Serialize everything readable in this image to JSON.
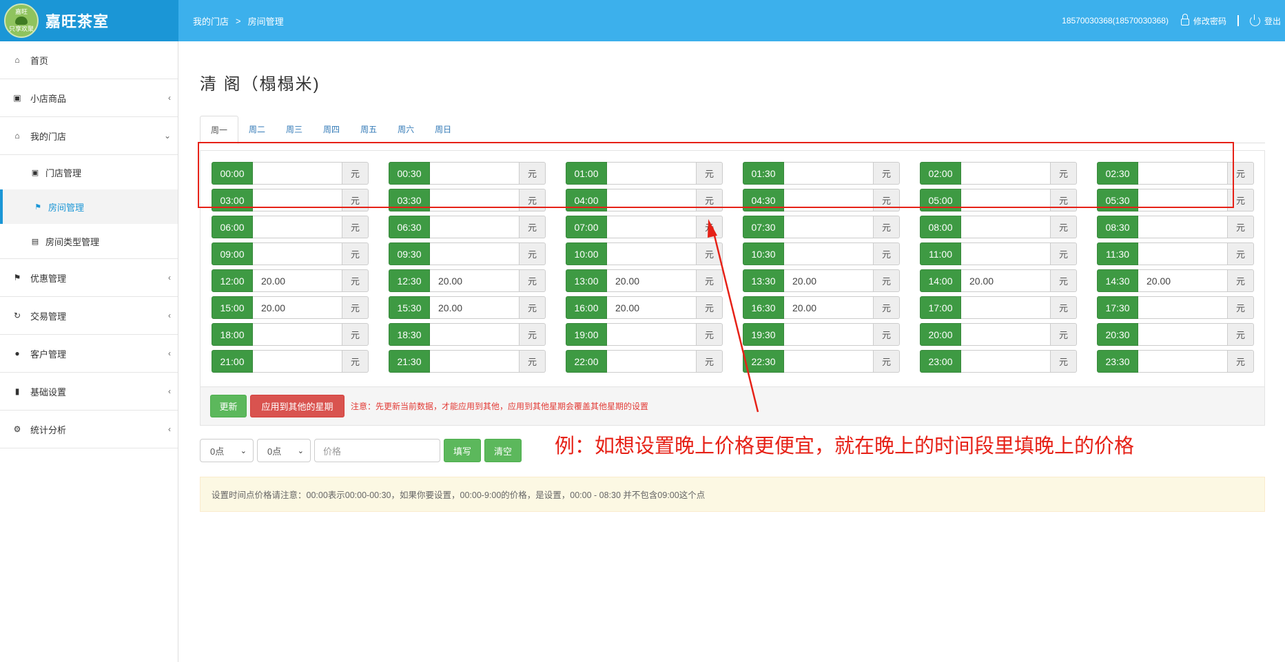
{
  "app": {
    "logo_text_top": "嘉旺",
    "logo_text_bottom": "只享欢聚",
    "logo_title": "嘉旺茶室"
  },
  "breadcrumb": {
    "items": [
      "我的门店",
      "房间管理"
    ],
    "separator": ">"
  },
  "user": {
    "account": "18570030368(18570030368)",
    "change_password": "修改密码",
    "logout": "登出"
  },
  "sidebar": {
    "items": [
      {
        "label": "首页",
        "icon": "home-icon",
        "chevron": ""
      },
      {
        "label": "小店商品",
        "icon": "gift-icon",
        "chevron": "‹"
      },
      {
        "label": "我的门店",
        "icon": "home-icon",
        "chevron": "⌄"
      },
      {
        "label": "门店管理",
        "icon": "inbox-icon"
      },
      {
        "label": "房间管理",
        "icon": "flag-icon"
      },
      {
        "label": "房间类型管理",
        "icon": "list-icon"
      },
      {
        "label": "优惠管理",
        "icon": "tags-icon",
        "chevron": "‹"
      },
      {
        "label": "交易管理",
        "icon": "refresh-icon",
        "chevron": "‹"
      },
      {
        "label": "客户管理",
        "icon": "user-icon",
        "chevron": "‹"
      },
      {
        "label": "基础设置",
        "icon": "barcode-icon",
        "chevron": "‹"
      },
      {
        "label": "统计分析",
        "icon": "gear-icon",
        "chevron": "‹"
      }
    ]
  },
  "page": {
    "title": "清 阁（榻榻米)"
  },
  "tabs": [
    "周一",
    "周二",
    "周三",
    "周四",
    "周五",
    "周六",
    "周日"
  ],
  "active_tab": "周一",
  "unit": "元",
  "slots": [
    {
      "time": "00:00",
      "value": ""
    },
    {
      "time": "00:30",
      "value": ""
    },
    {
      "time": "01:00",
      "value": ""
    },
    {
      "time": "01:30",
      "value": ""
    },
    {
      "time": "02:00",
      "value": ""
    },
    {
      "time": "02:30",
      "value": ""
    },
    {
      "time": "03:00",
      "value": ""
    },
    {
      "time": "03:30",
      "value": ""
    },
    {
      "time": "04:00",
      "value": ""
    },
    {
      "time": "04:30",
      "value": ""
    },
    {
      "time": "05:00",
      "value": ""
    },
    {
      "time": "05:30",
      "value": ""
    },
    {
      "time": "06:00",
      "value": ""
    },
    {
      "time": "06:30",
      "value": ""
    },
    {
      "time": "07:00",
      "value": ""
    },
    {
      "time": "07:30",
      "value": ""
    },
    {
      "time": "08:00",
      "value": ""
    },
    {
      "time": "08:30",
      "value": ""
    },
    {
      "time": "09:00",
      "value": ""
    },
    {
      "time": "09:30",
      "value": ""
    },
    {
      "time": "10:00",
      "value": ""
    },
    {
      "time": "10:30",
      "value": ""
    },
    {
      "time": "11:00",
      "value": ""
    },
    {
      "time": "11:30",
      "value": ""
    },
    {
      "time": "12:00",
      "value": "20.00"
    },
    {
      "time": "12:30",
      "value": "20.00"
    },
    {
      "time": "13:00",
      "value": "20.00"
    },
    {
      "time": "13:30",
      "value": "20.00"
    },
    {
      "time": "14:00",
      "value": "20.00"
    },
    {
      "time": "14:30",
      "value": "20.00"
    },
    {
      "time": "15:00",
      "value": "20.00"
    },
    {
      "time": "15:30",
      "value": "20.00"
    },
    {
      "time": "16:00",
      "value": "20.00"
    },
    {
      "time": "16:30",
      "value": "20.00"
    },
    {
      "time": "17:00",
      "value": ""
    },
    {
      "time": "17:30",
      "value": ""
    },
    {
      "time": "18:00",
      "value": ""
    },
    {
      "time": "18:30",
      "value": ""
    },
    {
      "time": "19:00",
      "value": ""
    },
    {
      "time": "19:30",
      "value": ""
    },
    {
      "time": "20:00",
      "value": ""
    },
    {
      "time": "20:30",
      "value": ""
    },
    {
      "time": "21:00",
      "value": ""
    },
    {
      "time": "21:30",
      "value": ""
    },
    {
      "time": "22:00",
      "value": ""
    },
    {
      "time": "22:30",
      "value": ""
    },
    {
      "time": "23:00",
      "value": ""
    },
    {
      "time": "23:30",
      "value": ""
    }
  ],
  "actions": {
    "update_label": "更新",
    "apply_label": "应用到其他的星期",
    "notice": "注意：先更新当前数据，才能应用到其他，应用到其他星期会覆盖其他星期的设置"
  },
  "tools": {
    "start_select": "0点",
    "end_select": "0点",
    "price_placeholder": "价格",
    "fill_label": "填写",
    "clear_label": "清空"
  },
  "tip": "设置时间点价格请注意：00:00表示00:00-00:30，如果你要设置，00:00-9:00的价格，是设置，00:00 - 08:30 并不包含09:00这个点",
  "annotation": {
    "text": "例：如想设置晚上价格更便宜，就在晚上的时间段里填晚上的价格",
    "color": "#e62117"
  },
  "colors": {
    "brand": "#1b96d6",
    "topbar": "#3cb0ec",
    "time_label": "#3e9a43",
    "danger": "#d9534f"
  }
}
